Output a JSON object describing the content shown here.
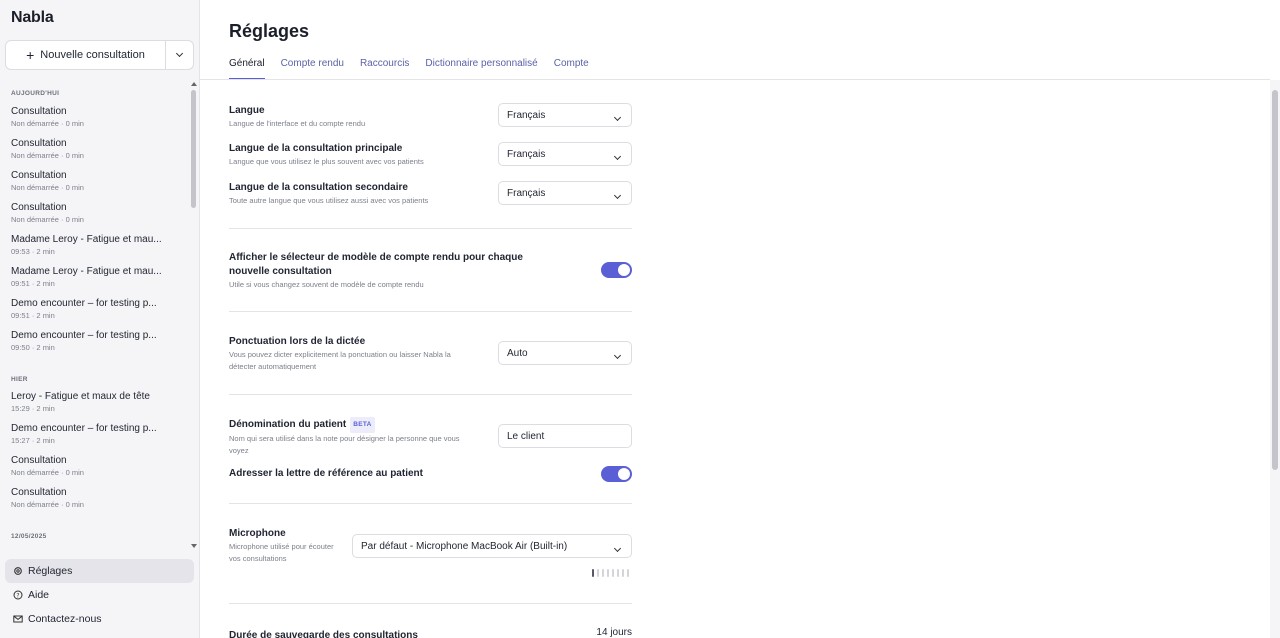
{
  "sidebar": {
    "logo": "Nabla",
    "new_consultation": "Nouvelle consultation",
    "groups": [
      {
        "label": "AUJOURD'HUI"
      },
      {
        "label": "HIER"
      },
      {
        "label": "12/05/2025"
      }
    ],
    "items": [
      {
        "title": "Consultation",
        "meta": "Non démarrée · 0 min"
      },
      {
        "title": "Consultation",
        "meta": "Non démarrée · 0 min"
      },
      {
        "title": "Consultation",
        "meta": "Non démarrée · 0 min"
      },
      {
        "title": "Consultation",
        "meta": "Non démarrée · 0 min"
      },
      {
        "title": "Madame Leroy - Fatigue et mau...",
        "meta": "09:53 · 2 min"
      },
      {
        "title": "Madame Leroy - Fatigue et mau...",
        "meta": "09:51 · 2 min"
      },
      {
        "title": "Demo encounter – for testing p...",
        "meta": "09:51 · 2 min"
      },
      {
        "title": "Demo encounter – for testing p...",
        "meta": "09:50 · 2 min"
      },
      {
        "title": "Leroy - Fatigue et maux de tête",
        "meta": "15:29 · 2 min"
      },
      {
        "title": "Demo encounter – for testing p...",
        "meta": "15:27 · 2 min"
      },
      {
        "title": "Consultation",
        "meta": "Non démarrée · 0 min"
      },
      {
        "title": "Consultation",
        "meta": "Non démarrée · 0 min"
      }
    ],
    "footer": {
      "settings": "Réglages",
      "help": "Aide",
      "contact": "Contactez-nous"
    }
  },
  "main": {
    "title": "Réglages",
    "tabs": [
      "Général",
      "Compte rendu",
      "Raccourcis",
      "Dictionnaire personnalisé",
      "Compte"
    ],
    "settings": {
      "language": {
        "label": "Langue",
        "desc": "Langue de l'interface et du compte rendu",
        "value": "Français"
      },
      "primary_language": {
        "label": "Langue de la consultation principale",
        "desc": "Langue que vous utilisez le plus souvent avec vos patients",
        "value": "Français"
      },
      "secondary_language": {
        "label": "Langue de la consultation secondaire",
        "desc": "Toute autre langue que vous utilisez aussi avec vos patients",
        "value": "Français"
      },
      "template_selector": {
        "label": "Afficher le sélecteur de modèle de compte rendu pour chaque nouvelle consultation",
        "desc": "Utile si vous changez souvent de modèle de compte rendu",
        "enabled": true
      },
      "punctuation": {
        "label": "Ponctuation lors de la dictée",
        "desc": "Vous pouvez dicter explicitement la ponctuation ou laisser Nabla la détecter automatiquement",
        "value": "Auto"
      },
      "patient_naming": {
        "label": "Dénomination du patient",
        "badge": "BETA",
        "desc": "Nom qui sera utilisé dans la note pour désigner la personne que vous voyez",
        "value": "Le client"
      },
      "referral_letter": {
        "label": "Adresser la lettre de référence au patient",
        "enabled": true
      },
      "microphone": {
        "label": "Microphone",
        "desc": "Microphone utilisé pour écouter vos consultations",
        "value": "Par défaut - Microphone MacBook Air (Built-in)",
        "level": 0.1
      },
      "retention": {
        "label": "Durée de sauvegarde des consultations",
        "value": "14 jours"
      }
    }
  },
  "colors": {
    "accent": "#5b5fd6",
    "tab_link": "#5b62a8",
    "sidebar_bg": "#f5f5f7"
  }
}
